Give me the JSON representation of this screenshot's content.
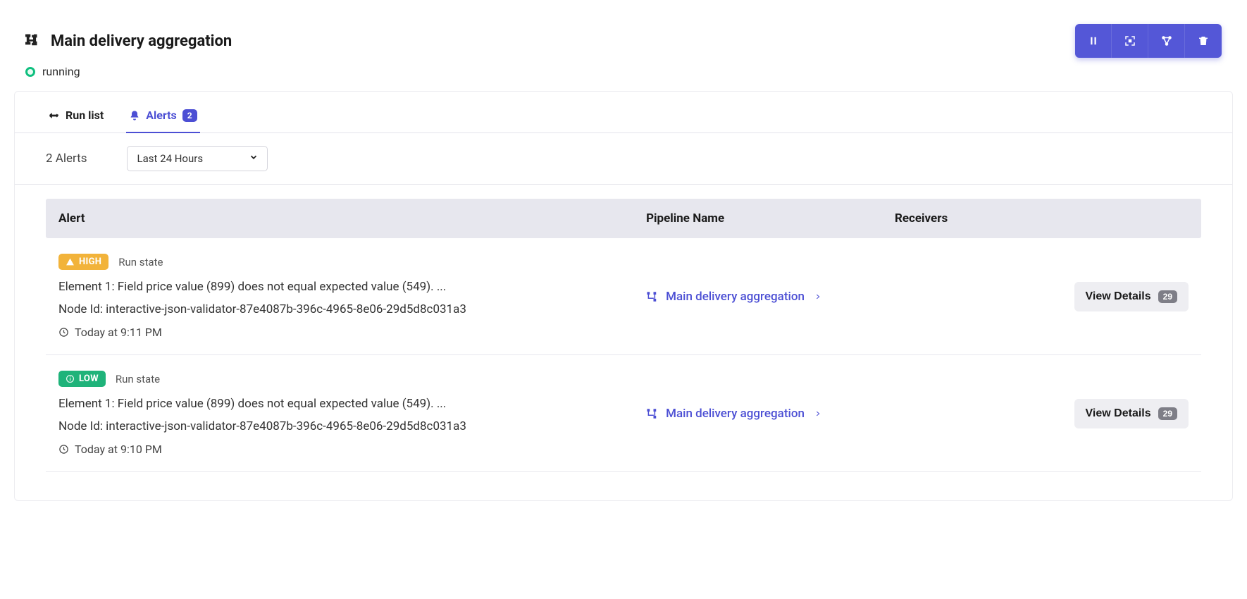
{
  "header": {
    "title": "Main delivery aggregation",
    "status_label": "running",
    "status_color": "#0fbf7f"
  },
  "tabs": {
    "run_list": {
      "label": "Run list"
    },
    "alerts": {
      "label": "Alerts",
      "count": "2"
    },
    "active": "alerts"
  },
  "filter": {
    "alerts_count_text": "2 Alerts",
    "time_range": "Last 24 Hours"
  },
  "table": {
    "columns": {
      "alert": "Alert",
      "pipeline": "Pipeline Name",
      "receivers": "Receivers"
    }
  },
  "alerts": [
    {
      "severity": "HIGH",
      "severity_class": "sev-high",
      "alert_type": "Run state",
      "message": "Element 1: Field price value (899) does not equal expected value (549). ...",
      "node_id": "Node Id: interactive-json-validator-87e4087b-396c-4965-8e06-29d5d8c031a3",
      "timestamp": "Today at 9:11 PM",
      "pipeline": "Main delivery aggregation",
      "view_label": "View Details",
      "view_count": "29"
    },
    {
      "severity": "LOW",
      "severity_class": "sev-low",
      "alert_type": "Run state",
      "message": "Element 1: Field price value (899) does not equal expected value (549). ...",
      "node_id": "Node Id: interactive-json-validator-87e4087b-396c-4965-8e06-29d5d8c031a3",
      "timestamp": "Today at 9:10 PM",
      "pipeline": "Main delivery aggregation",
      "view_label": "View Details",
      "view_count": "29"
    }
  ]
}
